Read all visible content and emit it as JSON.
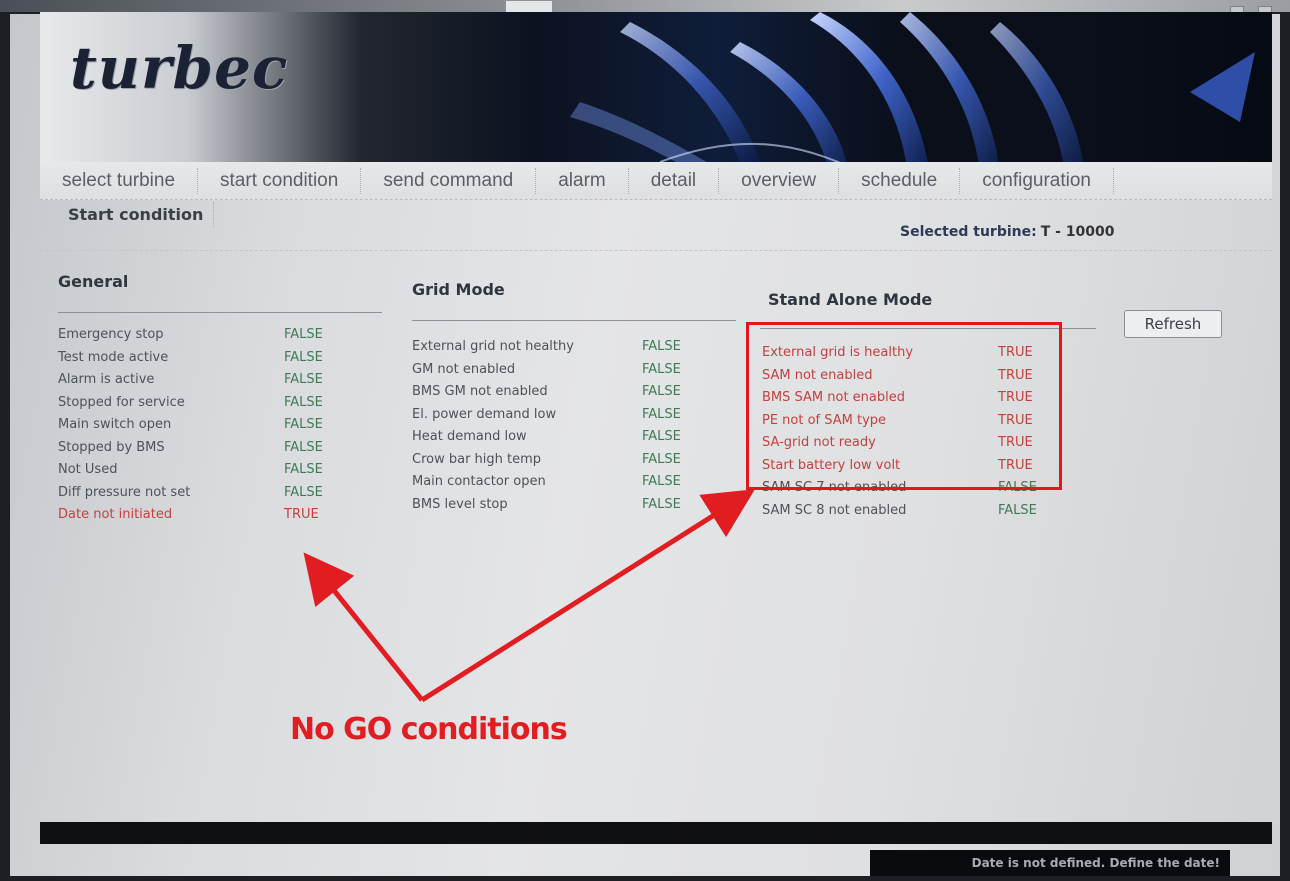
{
  "brand": {
    "logo_text": "turbec"
  },
  "nav": {
    "items": [
      {
        "label": "select turbine"
      },
      {
        "label": "start condition"
      },
      {
        "label": "send command"
      },
      {
        "label": "alarm"
      },
      {
        "label": "detail"
      },
      {
        "label": "overview"
      },
      {
        "label": "schedule"
      },
      {
        "label": "configuration"
      }
    ],
    "active_subpage": "Start condition"
  },
  "selected_turbine": {
    "label": "Selected turbine:",
    "value": "T - 10000"
  },
  "refresh_label": "Refresh",
  "general": {
    "title": "General",
    "rows": [
      {
        "label": "Emergency stop",
        "value": "FALSE"
      },
      {
        "label": "Test mode active",
        "value": "FALSE"
      },
      {
        "label": "Alarm is active",
        "value": "FALSE"
      },
      {
        "label": "Stopped for service",
        "value": "FALSE"
      },
      {
        "label": "Main switch open",
        "value": "FALSE"
      },
      {
        "label": "Stopped by BMS",
        "value": "FALSE"
      },
      {
        "label": "Not Used",
        "value": "FALSE"
      },
      {
        "label": "Diff pressure not set",
        "value": "FALSE"
      },
      {
        "label": "Date not initiated",
        "value": "TRUE"
      }
    ]
  },
  "grid_mode": {
    "title": "Grid Mode",
    "rows": [
      {
        "label": "External grid not healthy",
        "value": "FALSE"
      },
      {
        "label": "GM not enabled",
        "value": "FALSE"
      },
      {
        "label": "BMS GM not enabled",
        "value": "FALSE"
      },
      {
        "label": "El. power demand low",
        "value": "FALSE"
      },
      {
        "label": "Heat demand low",
        "value": "FALSE"
      },
      {
        "label": "Crow bar high temp",
        "value": "FALSE"
      },
      {
        "label": "Main contactor open",
        "value": "FALSE"
      },
      {
        "label": "BMS level stop",
        "value": "FALSE"
      }
    ]
  },
  "stand_alone_mode": {
    "title": "Stand Alone Mode",
    "rows": [
      {
        "label": "External grid is healthy",
        "value": "TRUE"
      },
      {
        "label": "SAM not enabled",
        "value": "TRUE"
      },
      {
        "label": "BMS SAM not enabled",
        "value": "TRUE"
      },
      {
        "label": "PE not of SAM type",
        "value": "TRUE"
      },
      {
        "label": "SA-grid not ready",
        "value": "TRUE"
      },
      {
        "label": "Start battery low volt",
        "value": "TRUE"
      },
      {
        "label": "SAM SC 7 not enabled",
        "value": "FALSE"
      },
      {
        "label": "SAM SC 8 not enabled",
        "value": "FALSE"
      }
    ]
  },
  "annotation": {
    "text": "No GO conditions",
    "color": "#e21d22"
  },
  "status_message": "Date is not defined. Define the date!",
  "colors": {
    "false_value": "#3f7a55",
    "true_value": "#c4403d",
    "highlight": "#e0171b"
  }
}
